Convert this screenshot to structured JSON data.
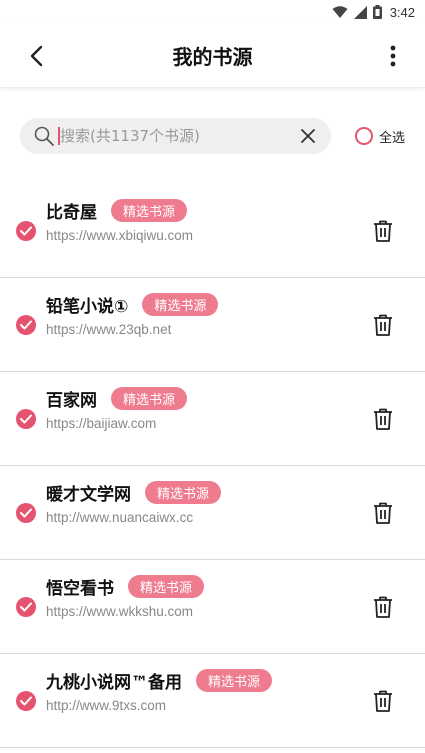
{
  "status_bar": {
    "time": "3:42",
    "icons": [
      "wifi-icon",
      "signal-icon",
      "battery-icon"
    ]
  },
  "app_bar": {
    "title": "我的书源",
    "back_icon": "arrow-back-icon",
    "more_icon": "more-vert-icon"
  },
  "search": {
    "placeholder": "搜索(共1137个书源)",
    "value": "",
    "search_icon": "search-icon",
    "clear_icon": "close-icon"
  },
  "select_all": {
    "label": "全选",
    "checked": false
  },
  "colors": {
    "accent": "#e5546f",
    "badge": "#ef7c8e",
    "divider": "#d9d9d9",
    "url": "#888888"
  },
  "sources": [
    {
      "name": "比奇屋",
      "badge": "精选书源",
      "url": "https://www.xbiqiwu.com",
      "checked": true
    },
    {
      "name": "铅笔小说①",
      "badge": "精选书源",
      "url": "https://www.23qb.net",
      "checked": true
    },
    {
      "name": "百家网",
      "badge": "精选书源",
      "url": "https://baijiaw.com",
      "checked": true
    },
    {
      "name": "暖才文学网",
      "badge": "精选书源",
      "url": "http://www.nuancaiwx.cc",
      "checked": true
    },
    {
      "name": "悟空看书",
      "badge": "精选书源",
      "url": "https://www.wkkshu.com",
      "checked": true
    },
    {
      "name": "九桃小说网™备用",
      "badge": "精选书源",
      "url": "http://www.9txs.com",
      "checked": true
    }
  ]
}
